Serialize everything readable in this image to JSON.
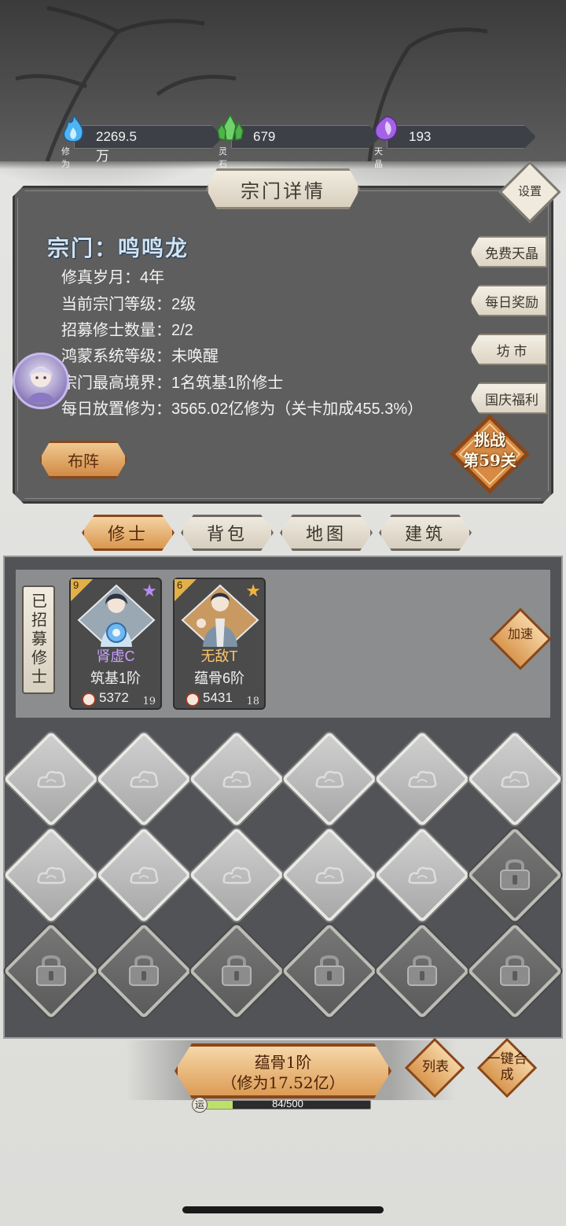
{
  "currencies": [
    {
      "icon": "blue-flame-icon",
      "label": "修为",
      "value": "2269.5万"
    },
    {
      "icon": "green-crystal-icon",
      "label": "灵石",
      "value": "679"
    },
    {
      "icon": "purple-crystal-icon",
      "label": "天晶",
      "value": "193"
    }
  ],
  "panel": {
    "title": "宗门详情",
    "settings_label": "设置",
    "sect_name": "宗门：鸣鸣龙",
    "info": [
      "修真岁月：4年",
      "当前宗门等级：2级",
      "招募修士数量：2/2",
      "鸿蒙系统等级：未唤醒",
      "宗门最高境界：1名筑基1阶修士",
      "每日放置修为：3565.02亿修为（关卡加成455.3%）"
    ],
    "side_buttons": [
      "免费天晶",
      "每日奖励",
      "坊 市",
      "国庆福利"
    ],
    "challenge_line1": "挑战",
    "challenge_line2": "第59关",
    "formation_label": "布阵"
  },
  "tabs": [
    "修士",
    "背包",
    "地图",
    "建筑"
  ],
  "active_tab": 0,
  "recruited": {
    "label": "已招募修士",
    "speed_label": "加速",
    "cards": [
      {
        "level": "9",
        "star_color": "#b58cf0",
        "name": "肾虚C",
        "name_color": "#c9a3ff",
        "realm": "筑基1阶",
        "power": "5372",
        "count": "19"
      },
      {
        "level": "6",
        "star_color": "#f2b43a",
        "name": "无敌T",
        "name_color": "#ffc66b",
        "realm": "蕴骨6阶",
        "power": "5431",
        "count": "18"
      }
    ]
  },
  "slots": {
    "rows": 3,
    "cols": 6,
    "empty_count": 11,
    "locked_count": 7
  },
  "bottom": {
    "breakthrough_line1": "蕴骨1阶",
    "breakthrough_line2": "（修为17.52亿）",
    "list_label": "列表",
    "merge_label": "一键合成",
    "luck_icon": "运",
    "luck_text": "84/500",
    "luck_progress": 0.168
  },
  "colors": {
    "accent_orange": "#d9974f",
    "panel_gray": "#5e5e5e",
    "sect_name_blue": "#cfe3f4"
  }
}
